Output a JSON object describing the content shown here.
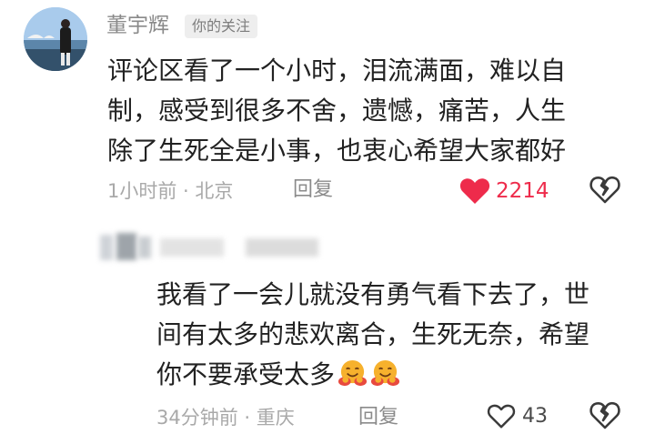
{
  "main_comment": {
    "author": "董宇辉",
    "follow_tag": "你的关注",
    "text_lines": [
      "评论区看了一个小时，泪流满面，难以自",
      "制，感受到很多不舍，遗憾，痛苦，人生",
      "除了生死全是小事，也衷心希望大家都好"
    ],
    "meta": "1小时前 · 北京",
    "reply_label": "回复",
    "like_count": "2214",
    "liked": true
  },
  "reply_comment": {
    "text_lines": [
      "我看了一会儿就没有勇气看下去了，世",
      "间有太多的悲欢离合，生死无奈，希望",
      "你不要承受太多"
    ],
    "emojis": [
      "hugging-face",
      "hugging-face"
    ],
    "meta": "34分钟前 · 重庆",
    "reply_label": "回复",
    "like_count": "43",
    "liked": false
  },
  "colors": {
    "like_red": "#ee2b4b",
    "text_primary": "#222222",
    "text_meta": "#a9a9a9",
    "tag_bg": "#eeeeee"
  }
}
